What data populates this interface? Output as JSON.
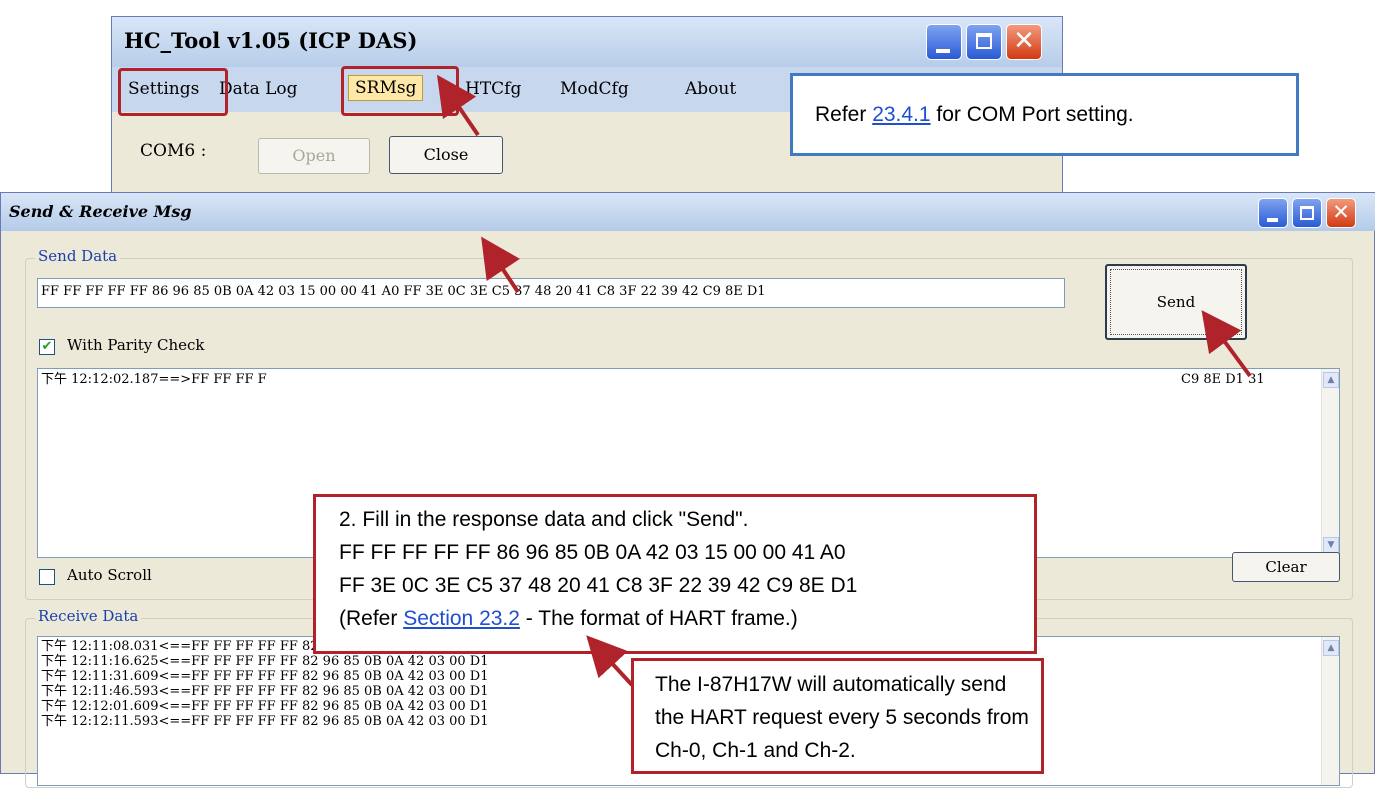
{
  "hc_tool": {
    "title": "HC_Tool v1.05  (ICP DAS)",
    "menu": [
      "Settings",
      "Data Log",
      "SRMsg",
      "HTCfg",
      "ModCfg",
      "About"
    ],
    "com_label": "COM6 :",
    "open_label": "Open",
    "close_label": "Close"
  },
  "note_com": {
    "prefix": "Refer ",
    "link": "23.4.1",
    "suffix": " for COM Port setting."
  },
  "sr_window": {
    "title": "Send & Receive Msg",
    "send_group": "Send Data",
    "send_input": "FF FF FF FF FF 86 96 85 0B 0A 42 03 15 00 00 41 A0 FF 3E 0C 3E C5 37 48 20 41 C8 3F 22 39 42 C9 8E D1",
    "send_button": "Send",
    "parity_label": "With Parity Check",
    "parity_checked": true,
    "sent_log_start": "下午 12:12:02.187==>FF FF FF F",
    "sent_log_end": "C9 8E D1 31",
    "auto_scroll_label": "Auto Scroll",
    "auto_scroll_checked": false,
    "clear_button": "Clear",
    "receive_group": "Receive Data",
    "receive_log": [
      "下午 12:11:08.031<==FF FF FF FF FF 82 96 85 0B 0A 42 03 00 D1",
      "下午 12:11:16.625<==FF FF FF FF FF 82 96 85 0B 0A 42 03 00 D1",
      "下午 12:11:31.609<==FF FF FF FF FF 82 96 85 0B 0A 42 03 00 D1",
      "下午 12:11:46.593<==FF FF FF FF FF 82 96 85 0B 0A 42 03 00 D1",
      "下午 12:12:01.609<==FF FF FF FF FF 82 96 85 0B 0A 42 03 00 D1",
      "下午 12:12:11.593<==FF FF FF FF FF 82 96 85 0B 0A 42 03 00 D1"
    ]
  },
  "callout_send": {
    "line1": "2. Fill in the response data and click \"Send\".",
    "line2": "FF FF FF FF FF 86 96 85 0B 0A 42 03 15 00 00 41 A0",
    "line3": "FF 3E 0C 3E C5 37 48 20 41 C8 3F 22 39 42 C9 8E D1",
    "line4_prefix": "(Refer ",
    "line4_link": "Section 23.2",
    "line4_suffix": " - The format of HART frame.)"
  },
  "callout_receive": {
    "line1": "The I-87H17W will automatically send",
    "line2": "the HART request every 5 seconds from",
    "line3": "Ch-0, Ch-1 and Ch-2."
  },
  "colors": {
    "annotation_red": "#b0232b",
    "note_blue": "#3f7ac3",
    "link": "#1f4fcf"
  }
}
